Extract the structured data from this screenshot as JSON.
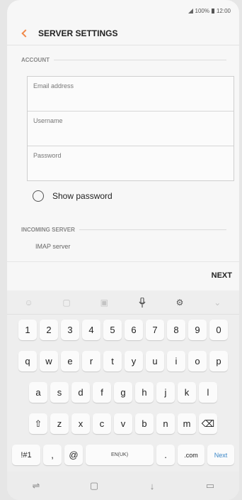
{
  "status": {
    "battery_text": "100%",
    "time": "12:00"
  },
  "appbar": {
    "title": "SERVER SETTINGS"
  },
  "account": {
    "section_label": "ACCOUNT",
    "email_placeholder": "Email address",
    "username_placeholder": "Username",
    "password_placeholder": "Password"
  },
  "show_password": {
    "label": "Show password",
    "checked": false
  },
  "incoming": {
    "section_label": "INCOMING SERVER",
    "server_label": "IMAP server"
  },
  "actions": {
    "next_label": "NEXT"
  },
  "keyboard": {
    "toolbar_icons": [
      "emoji-icon",
      "sticker-icon",
      "gif-icon",
      "microphone-icon",
      "settings-icon",
      "collapse-icon"
    ],
    "row1": [
      "1",
      "2",
      "3",
      "4",
      "5",
      "6",
      "7",
      "8",
      "9",
      "0"
    ],
    "row2": [
      "q",
      "w",
      "e",
      "r",
      "t",
      "y",
      "u",
      "i",
      "o",
      "p"
    ],
    "row3": [
      "a",
      "s",
      "d",
      "f",
      "g",
      "h",
      "j",
      "k",
      "l"
    ],
    "row4": [
      "z",
      "x",
      "c",
      "v",
      "b",
      "n",
      "m"
    ],
    "shift_glyph": "⇧",
    "backspace_glyph": "⌫",
    "sym_label": "!#1",
    "comma_label": ",",
    "at_label": "@",
    "space_label": "EN(UK)",
    "period_label": ".",
    "com_label": ".com",
    "next_key_label": "Next"
  },
  "navbar": {
    "icons": [
      "recent-apps-icon",
      "home-icon",
      "back-icon",
      "keyboard-hide-icon"
    ]
  }
}
